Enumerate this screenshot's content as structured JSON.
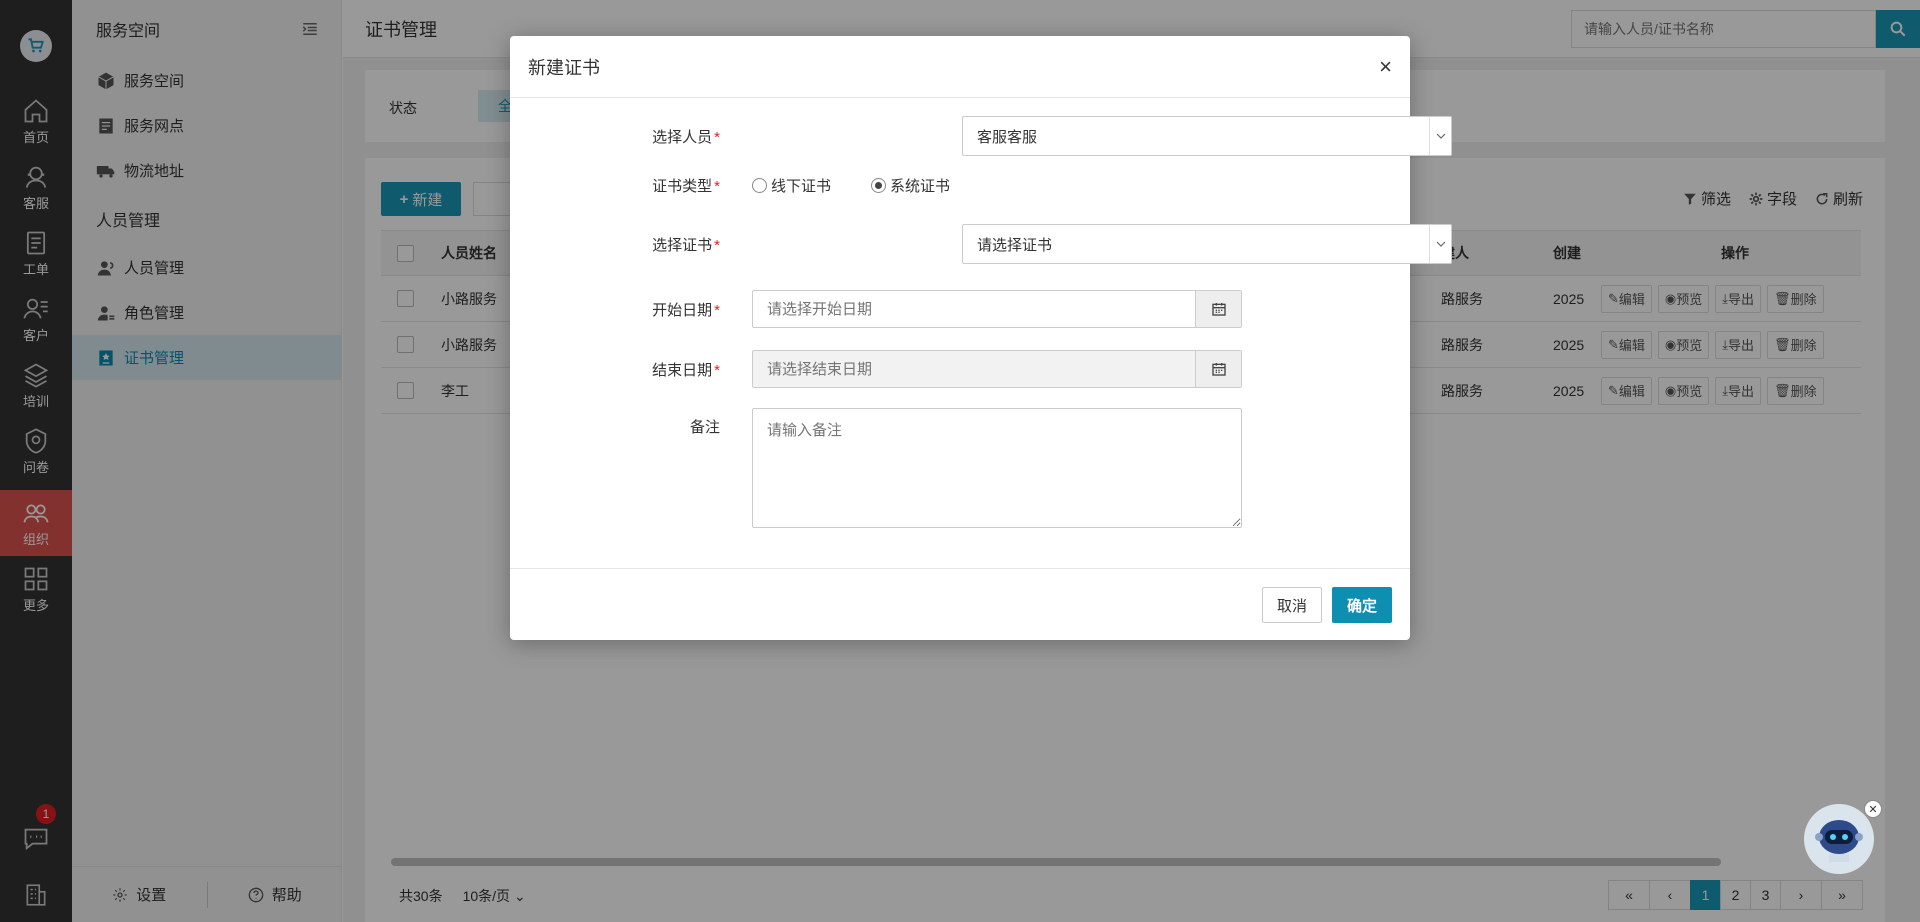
{
  "rail": {
    "items": [
      {
        "label": "首页",
        "icon": "home-icon"
      },
      {
        "label": "客服",
        "icon": "headset-icon"
      },
      {
        "label": "工单",
        "icon": "clipboard-icon"
      },
      {
        "label": "客户",
        "icon": "users-icon"
      },
      {
        "label": "培训",
        "icon": "layers-icon"
      },
      {
        "label": "问卷",
        "icon": "shield-icon"
      },
      {
        "label": "组织",
        "icon": "group-icon",
        "active": true
      },
      {
        "label": "更多",
        "icon": "grid-icon"
      }
    ],
    "chat_badge": "1"
  },
  "sidebar": {
    "title": "服务空间",
    "items": [
      {
        "label": "服务空间",
        "icon": "cube-icon"
      },
      {
        "label": "服务网点",
        "icon": "store-icon"
      },
      {
        "label": "物流地址",
        "icon": "truck-icon"
      }
    ],
    "group": "人员管理",
    "group_items": [
      {
        "label": "人员管理",
        "icon": "user-icon"
      },
      {
        "label": "角色管理",
        "icon": "user-role-icon"
      },
      {
        "label": "证书管理",
        "icon": "certificate-icon",
        "active": true
      }
    ],
    "settings": "设置",
    "help": "帮助"
  },
  "header": {
    "title": "证书管理",
    "search_placeholder": "请输入人员/证书名称"
  },
  "filter": {
    "status_label": "状态",
    "status_chip": "全"
  },
  "toolbar": {
    "new_label": "新建",
    "filter_label": "筛选",
    "fields_label": "字段",
    "refresh_label": "刷新"
  },
  "table": {
    "headers": {
      "name": "人员姓名",
      "creator": "建人",
      "date": "创建",
      "ops": "操作"
    },
    "rows": [
      {
        "name": "小路服务",
        "creator": "路服务",
        "date": "2025"
      },
      {
        "name": "小路服务",
        "creator": "路服务",
        "date": "2025"
      },
      {
        "name": "李工",
        "creator": "路服务",
        "date": "2025"
      }
    ],
    "ops": {
      "edit": "编辑",
      "preview": "预览",
      "export": "导出",
      "delete": "删除"
    }
  },
  "pagination": {
    "total": "共30条",
    "page_size": "10条/页",
    "first": "«",
    "prev": "‹",
    "pages": [
      "1",
      "2",
      "3"
    ],
    "next": "›",
    "last": "»"
  },
  "modal": {
    "title": "新建证书",
    "close": "×",
    "person_label": "选择人员",
    "person_value": "客服客服",
    "type_label": "证书类型",
    "type_option_offline": "线下证书",
    "type_option_system": "系统证书",
    "cert_label": "选择证书",
    "cert_value": "请选择证书",
    "start_label": "开始日期",
    "start_placeholder": "请选择开始日期",
    "end_label": "结束日期",
    "end_placeholder": "请选择结束日期",
    "note_label": "备注",
    "note_placeholder": "请输入备注",
    "required_mark": "*",
    "cancel": "取消",
    "confirm": "确定"
  },
  "colors": {
    "accent": "#1a96b4",
    "rail_bg": "#333333",
    "active_rail": "#d9534f",
    "required": "#e02020"
  }
}
